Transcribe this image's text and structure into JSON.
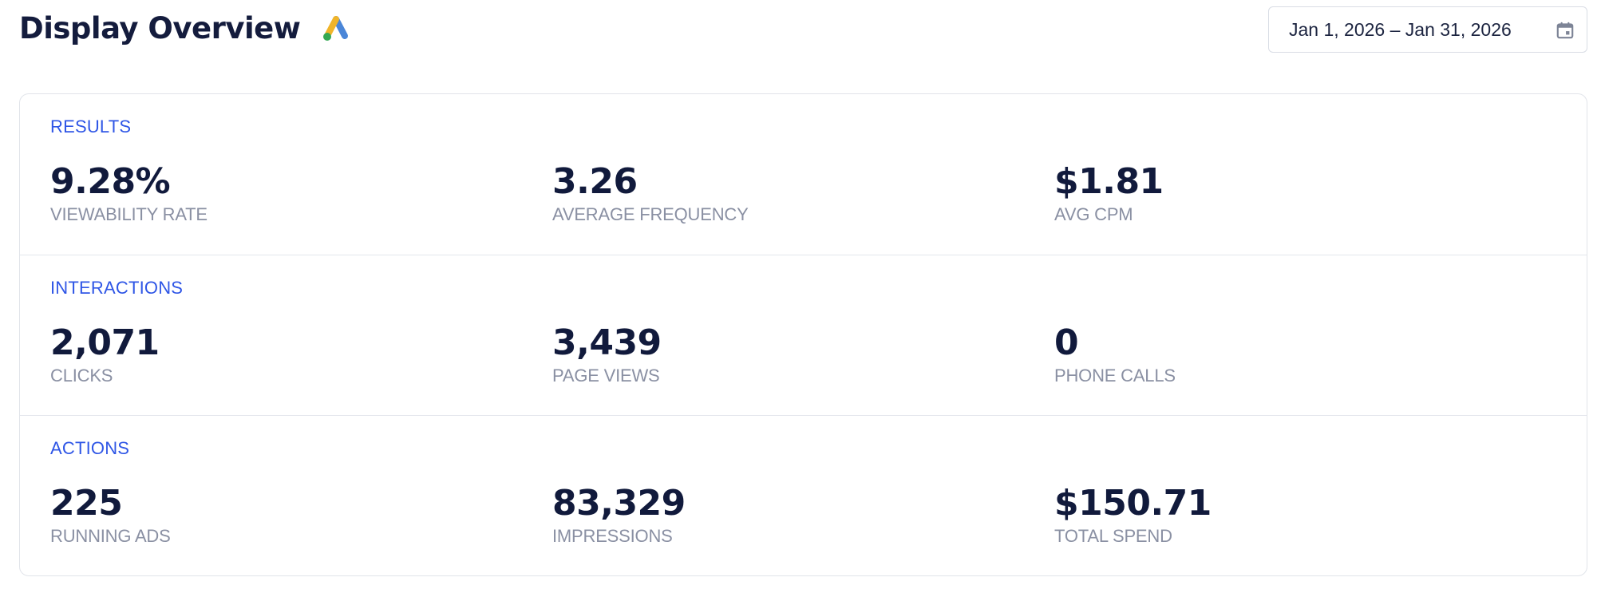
{
  "header": {
    "title": "Display Overview",
    "logo_icon": "google-ads-logo",
    "date_range": "Jan 1, 2026 – Jan 31, 2026",
    "calendar_icon": "calendar-icon"
  },
  "colors": {
    "title": "#141c3d",
    "section_title": "#2f56e6",
    "metric_value": "#111a3c",
    "metric_label": "#8a90a3"
  },
  "sections": [
    {
      "title": "RESULTS",
      "metrics": [
        {
          "value": "9.28%",
          "label": "VIEWABILITY RATE"
        },
        {
          "value": "3.26",
          "label": "AVERAGE FREQUENCY"
        },
        {
          "value": "$1.81",
          "label": "AVG CPM"
        }
      ]
    },
    {
      "title": "INTERACTIONS",
      "metrics": [
        {
          "value": "2,071",
          "label": "CLICKS"
        },
        {
          "value": "3,439",
          "label": "PAGE VIEWS"
        },
        {
          "value": "0",
          "label": "PHONE CALLS"
        }
      ]
    },
    {
      "title": "ACTIONS",
      "metrics": [
        {
          "value": "225",
          "label": "RUNNING ADS"
        },
        {
          "value": "83,329",
          "label": "IMPRESSIONS"
        },
        {
          "value": "$150.71",
          "label": "TOTAL SPEND"
        }
      ]
    }
  ]
}
